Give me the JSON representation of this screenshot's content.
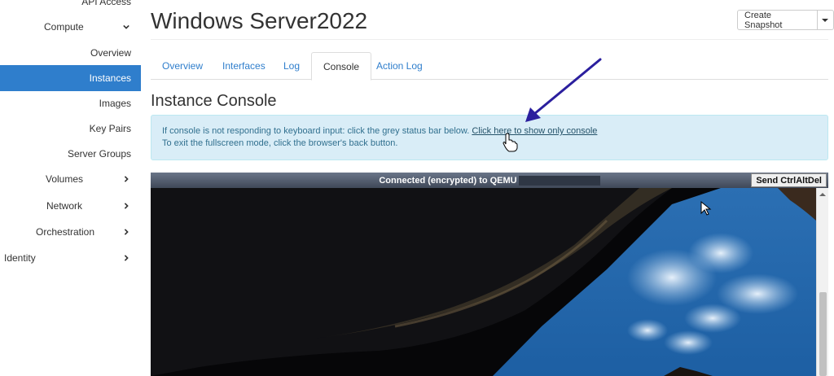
{
  "sidebar": {
    "top_cut": "API Access",
    "items": [
      {
        "label": "Compute",
        "chevron": "down"
      },
      {
        "label": "Overview"
      },
      {
        "label": "Instances",
        "active": true
      },
      {
        "label": "Images"
      },
      {
        "label": "Key Pairs"
      },
      {
        "label": "Server Groups"
      },
      {
        "label": "Volumes",
        "chevron": "right"
      },
      {
        "label": "Network",
        "chevron": "right"
      },
      {
        "label": "Orchestration",
        "chevron": "right"
      },
      {
        "label": "Identity",
        "chevron": "right"
      }
    ]
  },
  "header": {
    "title": "Windows Server2022",
    "snapshot_label": "Create Snapshot"
  },
  "tabs": [
    {
      "label": "Overview"
    },
    {
      "label": "Interfaces"
    },
    {
      "label": "Log"
    },
    {
      "label": "Console",
      "active": true
    },
    {
      "label": "Action Log"
    }
  ],
  "section": {
    "title": "Instance Console"
  },
  "alert": {
    "line1": "If console is not responding to keyboard input: click the grey status bar below.",
    "link": "Click here to show only console",
    "line2": "To exit the fullscreen mode, click the browser's back button."
  },
  "console": {
    "status": "Connected (encrypted) to QEMU",
    "ctrl_alt_del": "Send CtrlAltDel"
  },
  "colors": {
    "accent": "#2f7ecc",
    "alert_bg": "#d9edf7",
    "alert_text": "#31708f",
    "annotation_arrow": "#2b1f9e"
  },
  "icons": {
    "chevron_down": "chevron-down-icon",
    "chevron_right": "chevron-right-icon",
    "caret": "caret-down-icon",
    "arrow": "annotation-arrow-icon",
    "hand_cursor": "hand-cursor-icon",
    "mouse_pointer": "mouse-pointer-icon"
  }
}
